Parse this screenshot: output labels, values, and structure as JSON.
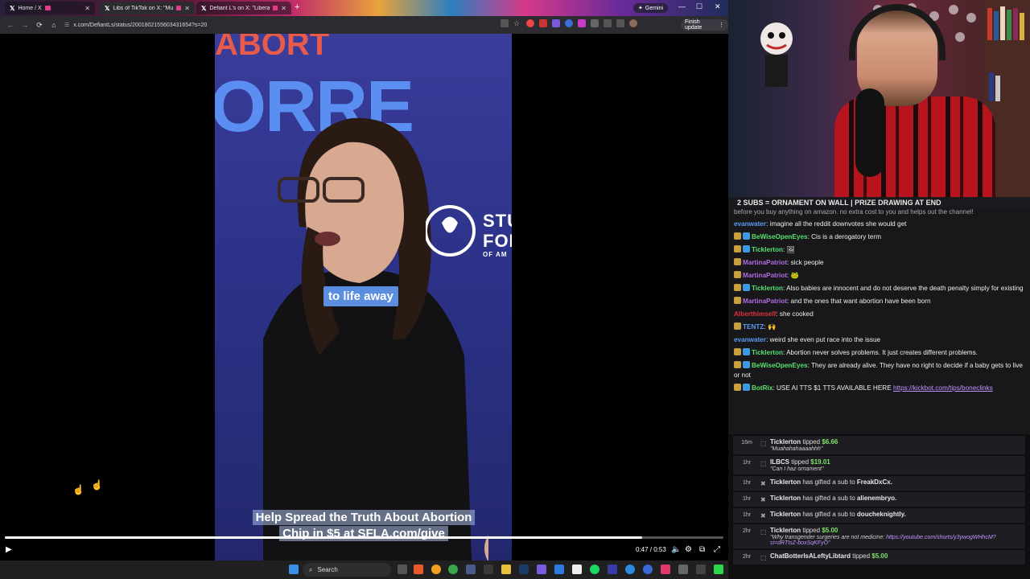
{
  "browser": {
    "tabs": [
      {
        "title": "Home / X",
        "active": false
      },
      {
        "title": "Libs of TikTok on X: \"Musli",
        "active": true
      },
      {
        "title": "Defiant L's on X: \"Liberal",
        "active": false
      }
    ],
    "new_tab": "+",
    "gemini_label": "Gemini",
    "url": "x.com/DefiantLs/status/2001802155603431654?s=20",
    "finish_update_label": "Finish update"
  },
  "video": {
    "banner_text": "ABORT",
    "big_word_1": "ORRE",
    "org_text_1": "STU",
    "org_text_2": "FOR",
    "org_text_3": "OF AM",
    "caption": "to life away",
    "bottom_caption_1": "Help Spread the Truth About Abortion",
    "bottom_caption_2": "Chip in $5 at SFLA.com/give",
    "time_display": "0:47 / 0:53",
    "progress": 0.887
  },
  "taskbar": {
    "search_label": "Search"
  },
  "stream": {
    "sub_banner": "2 SUBS = ORNAMENT ON WALL | PRIZE DRAWING AT END"
  },
  "chat": {
    "top_cut": "before you buy anything on amazon. no extra cost to you and helps out the channel!",
    "messages": [
      {
        "user": "evanwater",
        "color": "#5b9bf0",
        "text": "imagine all the reddit downvotes she would get",
        "badges": 0
      },
      {
        "user": "BeWiseOpenEyes",
        "color": "#58e06a",
        "text": "Cis is a derogatory term",
        "badges": 2
      },
      {
        "user": "Ticklerton",
        "color": "#58e06a",
        "text": "🖼",
        "badges": 2
      },
      {
        "user": "MartinaPatriot",
        "color": "#b06ae0",
        "text": "sick people",
        "badges": 1
      },
      {
        "user": "MartinaPatriot",
        "color": "#b06ae0",
        "text": "🐸",
        "badges": 1
      },
      {
        "user": "Ticklerton",
        "color": "#58e06a",
        "text": "Also babies are innocent and do not deserve the death penalty simply for existing",
        "badges": 2
      },
      {
        "user": "MartinaPatriot",
        "color": "#b06ae0",
        "text": "and the ones that want abortion have been born",
        "badges": 1
      },
      {
        "user": "Alberthimself",
        "color": "#e0303a",
        "text": "she cooked",
        "badges": 0
      },
      {
        "user": "TENTZ",
        "color": "#5b9bf0",
        "text": "🙌",
        "badges": 1
      },
      {
        "user": "evanwater",
        "color": "#5b9bf0",
        "text": "weird she even put race into the issue",
        "badges": 0
      },
      {
        "user": "Ticklerton",
        "color": "#58e06a",
        "text": "Abortion never solves problems. It just creates different problems.",
        "badges": 2
      },
      {
        "user": "BeWiseOpenEyes",
        "color": "#58e06a",
        "text": "They are already alive. They have no right to decide if a baby gets to live or not",
        "badges": 2
      },
      {
        "user": "BotRix",
        "color": "#58e06a",
        "text": "USE AI TTS $1 TTS AVAILABLE HERE",
        "link": "https://kickbot.com/tips/boneclinks",
        "badges": 2
      }
    ]
  },
  "events": [
    {
      "ago": "16m",
      "name": "Ticklerton",
      "action": "tipped",
      "amount": "$6.66",
      "message": "\"Muahahahaaaahhh\""
    },
    {
      "ago": "1hr",
      "name": "ILBCS",
      "action": "tipped",
      "amount": "$19.01",
      "message": "\"Can I haz ornament\""
    },
    {
      "ago": "1hr",
      "name": "Ticklerton",
      "action": "has gifted a sub to",
      "target": "FreakDxCx."
    },
    {
      "ago": "1hr",
      "name": "Ticklerton",
      "action": "has gifted a sub to",
      "target": "alienembryo."
    },
    {
      "ago": "1hr",
      "name": "Ticklerton",
      "action": "has gifted a sub to",
      "target": "doucheknightly."
    },
    {
      "ago": "2hr",
      "name": "Ticklerton",
      "action": "tipped",
      "amount": "$5.00",
      "message": "\"Why transgender surgeries are not medicine:",
      "link": "https://youtube.com/shorts/y3ywogWHhcM?si=dRTIsZ-boxSqKFyO\""
    },
    {
      "ago": "2hr",
      "name": "ChatBotterIsALeftyLibtard",
      "action": "tipped",
      "amount": "$5.00",
      "message": ""
    }
  ]
}
